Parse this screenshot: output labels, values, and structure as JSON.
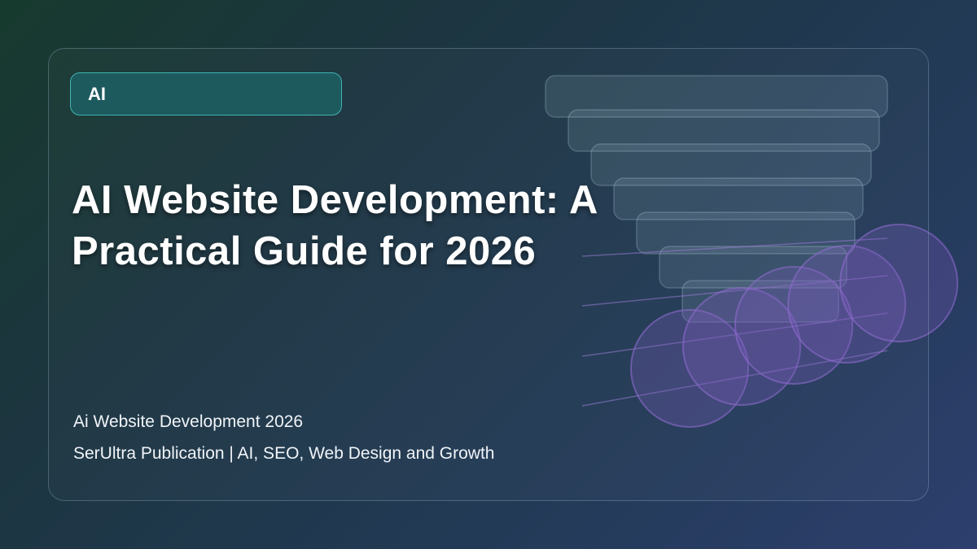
{
  "tag": {
    "label": "AI"
  },
  "title": {
    "line1": "AI Website Development: A",
    "line2": "Practical Guide for 2026"
  },
  "subtitle": "Ai Website Development 2026",
  "publication": "SerUltra Publication | AI, SEO, Web Design and Growth",
  "colors": {
    "accent_teal": "#3fb3b0",
    "tag_fill": "#1d5a5e",
    "accent_purple": "#7a5bb8"
  },
  "decor": {
    "icons": [
      "stacked-bars-illustration",
      "overlapping-circles-illustration"
    ]
  }
}
